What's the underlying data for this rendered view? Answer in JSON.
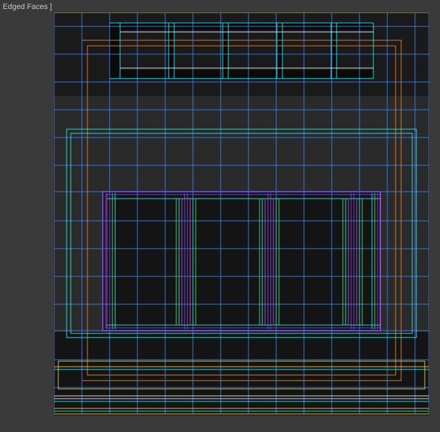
{
  "viewport": {
    "label": "Edged Faces ]",
    "mode": "wireframe_overlay"
  },
  "colors": {
    "blue": "#3a7bd8",
    "cyan": "#2dd8e0",
    "yellow": "#e0c040",
    "orange": "#d87f30",
    "magenta": "#d040d0",
    "purple": "#6a4ad0",
    "green": "#4ad060",
    "white": "#e0e0e0"
  }
}
